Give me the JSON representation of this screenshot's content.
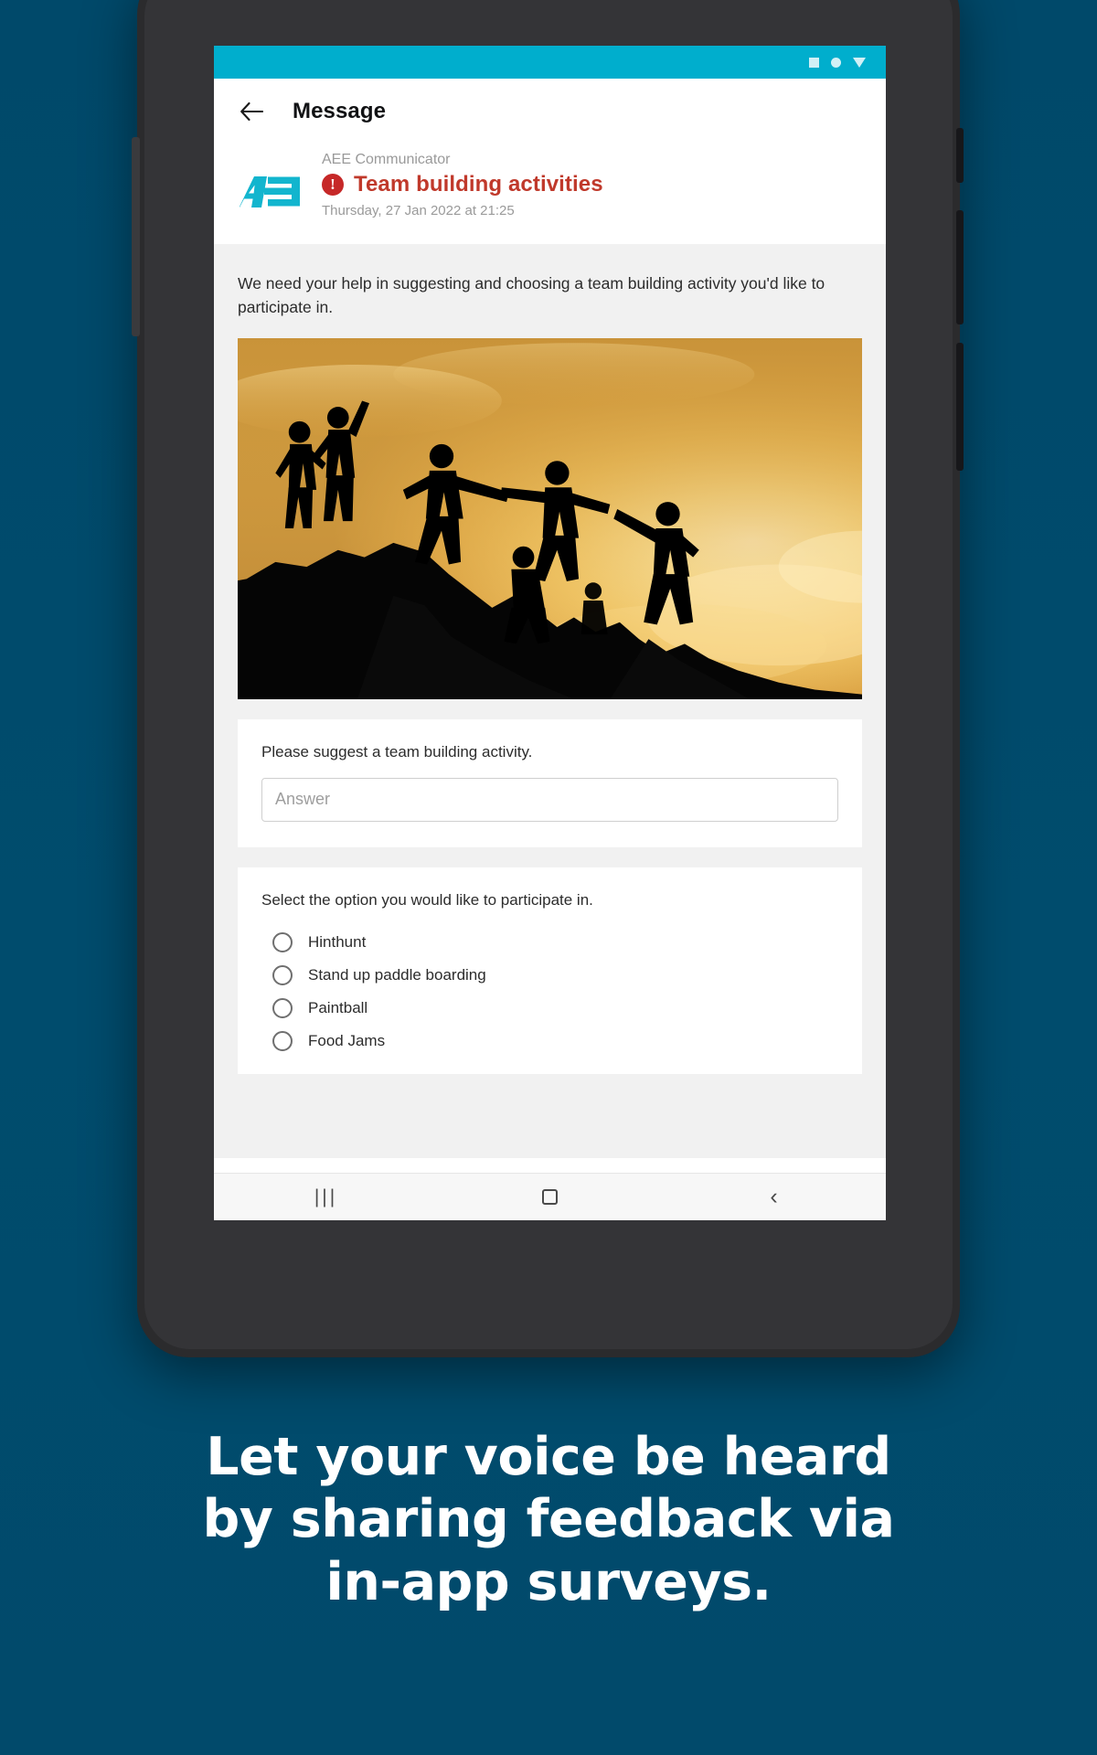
{
  "theme": {
    "page_background": "#004d6e",
    "status_bar_color": "#00aecd",
    "brand_cyan": "#12b5ce",
    "priority_red": "#c0392b",
    "card_background": "#ffffff",
    "body_background": "#f1f1f1"
  },
  "status_bar": {
    "icons": [
      "square-icon",
      "dot-icon",
      "triangle-down-icon"
    ]
  },
  "app_bar": {
    "back_label": "back-arrow",
    "title": "Message"
  },
  "message": {
    "logo_text": "AEE",
    "sender": "AEE Communicator",
    "priority_glyph": "!",
    "subject": "Team building activities",
    "timestamp": "Thursday, 27 Jan 2022 at 21:25",
    "body": "We need your help in suggesting and choosing a team building activity you'd like to participate in.",
    "image_alt": "team-building-silhouette-photo"
  },
  "survey": {
    "free_text_question": {
      "label": "Please suggest a team building activity.",
      "value": "",
      "placeholder": "Answer"
    },
    "choice_question": {
      "label": "Select the option you would like to participate in.",
      "options": [
        {
          "label": "Hinthunt",
          "selected": false
        },
        {
          "label": "Stand up paddle boarding",
          "selected": false
        },
        {
          "label": "Paintball",
          "selected": false
        },
        {
          "label": "Food Jams",
          "selected": false
        }
      ]
    }
  },
  "nav_bar": {
    "recents": "|||",
    "home": "home-square-icon",
    "back": "‹"
  },
  "caption": {
    "lines": [
      "Let your voice be heard",
      "by sharing feedback via",
      "in-app surveys."
    ]
  }
}
